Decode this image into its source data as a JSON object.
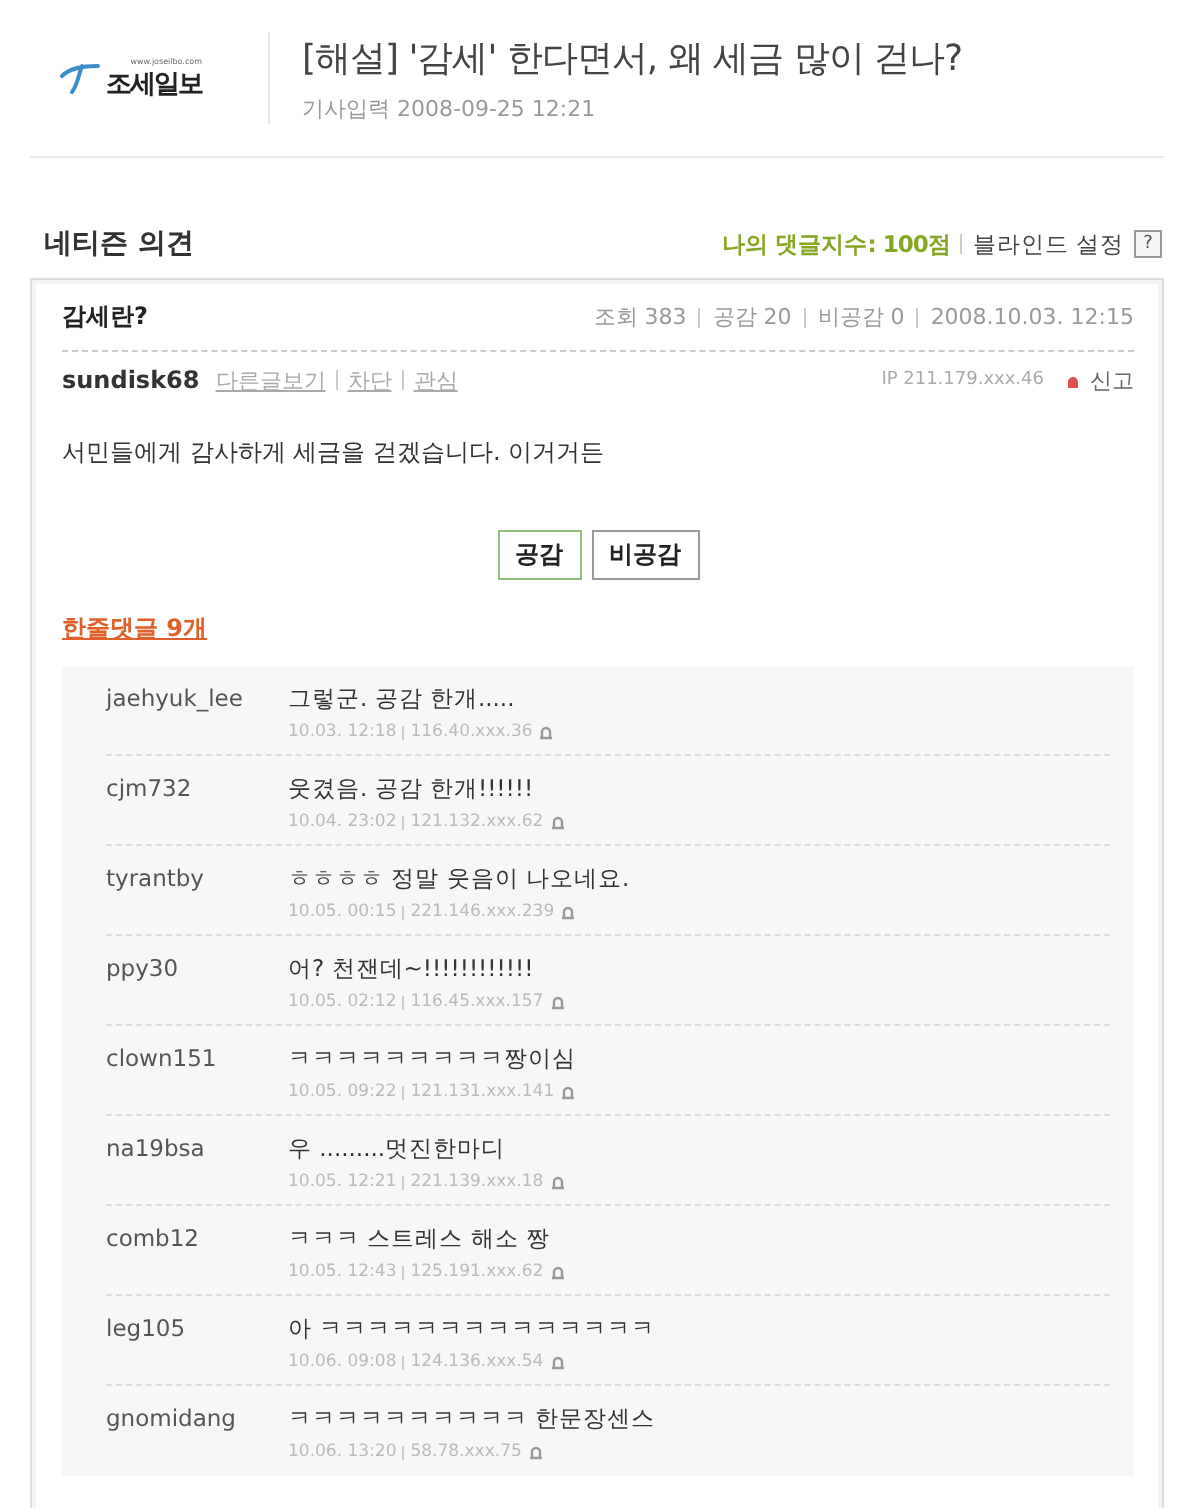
{
  "header": {
    "logo": {
      "url": "www.joseilbo.com",
      "name": "조세일보"
    },
    "headline": "[해설] '감세' 한다면서, 왜 세금 많이 걷나?",
    "published": "기사입력 2008-09-25 12:21"
  },
  "section": {
    "title": "네티즌 의견",
    "my_score": "나의 댓글지수: 100점",
    "blind_setting": "블라인드 설정",
    "help": "?"
  },
  "post": {
    "title": "감세란?",
    "stats": [
      "조회 383",
      "공감 20",
      "비공감 0",
      "2008.10.03. 12:15"
    ],
    "author": "sundisk68",
    "author_links": [
      "다른글보기",
      "차단",
      "관심"
    ],
    "ip": "IP 211.179.xxx.46",
    "report": "신고",
    "body": "서민들에게 감사하게 세금을 걷겠습니다. 이거거든",
    "buttons": [
      {
        "label": "공감",
        "kind": "agree"
      },
      {
        "label": "비공감",
        "kind": "disagree"
      }
    ]
  },
  "replies_label": "한줄댓글 9개",
  "replies": [
    {
      "user": "jaehyuk_lee",
      "text": "그렇군. 공감 한개.....",
      "time": "10.03. 12:18",
      "ip": "116.40.xxx.36"
    },
    {
      "user": "cjm732",
      "text": "웃겼음. 공감 한개!!!!!!",
      "time": "10.04. 23:02",
      "ip": "121.132.xxx.62"
    },
    {
      "user": "tyrantby",
      "text": "ㅎㅎㅎㅎ 정말 웃음이 나오네요.",
      "time": "10.05. 00:15",
      "ip": "221.146.xxx.239"
    },
    {
      "user": "ppy30",
      "text": "어? 천잰데~!!!!!!!!!!!!",
      "time": "10.05. 02:12",
      "ip": "116.45.xxx.157"
    },
    {
      "user": "clown151",
      "text": "ㅋㅋㅋㅋㅋㅋㅋㅋㅋ짱이심",
      "time": "10.05. 09:22",
      "ip": "121.131.xxx.141"
    },
    {
      "user": "na19bsa",
      "text": "우 .........멋진한마디",
      "time": "10.05. 12:21",
      "ip": "221.139.xxx.18"
    },
    {
      "user": "comb12",
      "text": "ㅋㅋㅋ 스트레스 해소 짱",
      "time": "10.05. 12:43",
      "ip": "125.191.xxx.62"
    },
    {
      "user": "leg105",
      "text": "아 ㅋㅋㅋㅋㅋㅋㅋㅋㅋㅋㅋㅋㅋㅋ",
      "time": "10.06. 09:08",
      "ip": "124.136.xxx.54"
    },
    {
      "user": "gnomidang",
      "text": "ㅋㅋㅋㅋㅋㅋㅋㅋㅋㅋ 한문장센스",
      "time": "10.06. 13:20",
      "ip": "58.78.xxx.75"
    }
  ]
}
